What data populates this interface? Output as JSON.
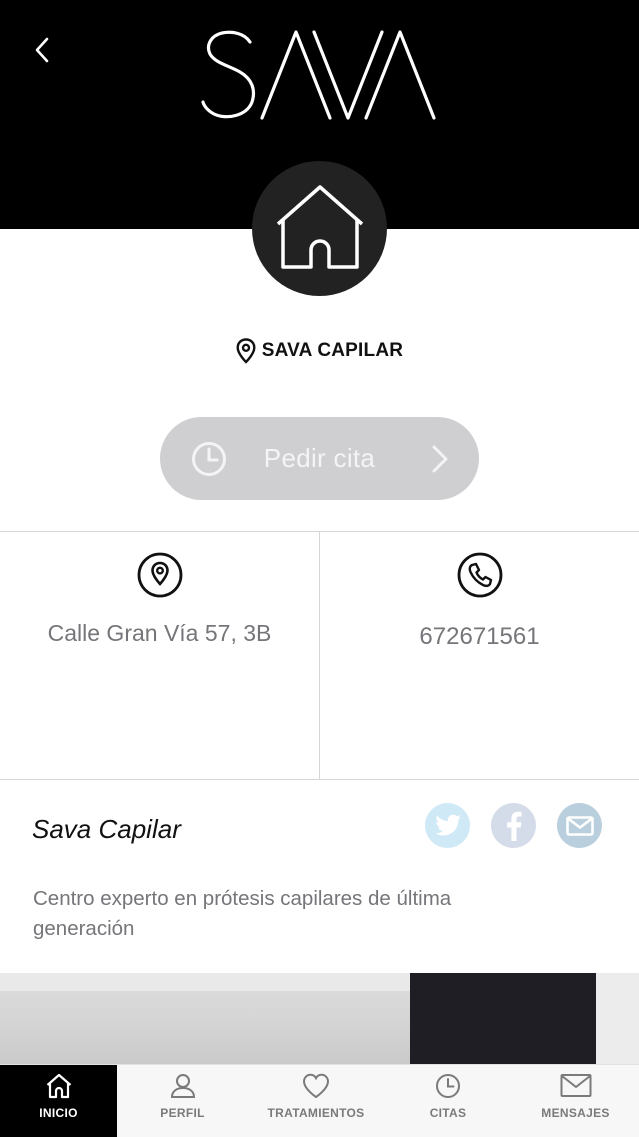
{
  "header": {
    "brand": "SAVA",
    "back_icon": "chevron-left-icon",
    "avatar_icon": "home-icon"
  },
  "location": {
    "icon": "map-pin-icon",
    "name": "SAVA CAPILAR"
  },
  "cta": {
    "label": "Pedir cita",
    "left_icon": "clock-icon",
    "right_icon": "chevron-right-icon"
  },
  "contact": {
    "address": "Calle Gran Vía 57, 3B",
    "address_icon": "location-icon",
    "phone": "672671561",
    "phone_icon": "phone-icon"
  },
  "business": {
    "name": "Sava Capilar",
    "description": "Centro experto en prótesis capilares de última generación",
    "social": [
      {
        "name": "twitter-icon",
        "color": "#cfe9f7"
      },
      {
        "name": "facebook-icon",
        "color": "#d4dbe9"
      },
      {
        "name": "email-icon",
        "color": "#b9cfdd"
      }
    ]
  },
  "tabs": [
    {
      "label": "INICIO",
      "icon": "home-icon",
      "active": true
    },
    {
      "label": "PERFIL",
      "icon": "user-icon",
      "active": false
    },
    {
      "label": "TRATAMIENTOS",
      "icon": "heart-icon",
      "active": false
    },
    {
      "label": "CITAS",
      "icon": "clock-icon",
      "active": false
    },
    {
      "label": "MENSAJES",
      "icon": "mail-icon",
      "active": false
    }
  ],
  "colors": {
    "header_bg": "#000000",
    "cta_bg": "#cfcfd2",
    "muted_text": "#75757a"
  }
}
